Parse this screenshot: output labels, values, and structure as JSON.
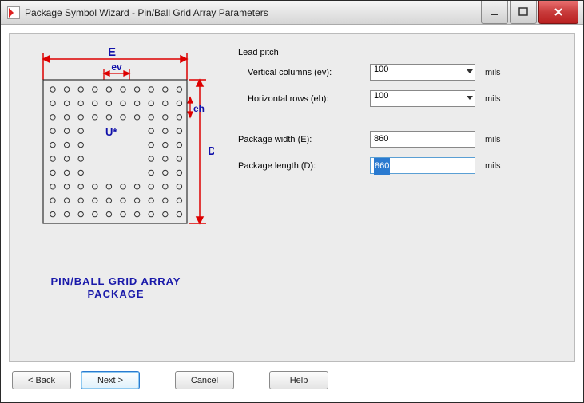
{
  "window": {
    "title": "Package Symbol Wizard - Pin/Ball Grid Array Parameters"
  },
  "diagram": {
    "dim_E": "E",
    "dim_ev": "ev",
    "dim_eh": "eh",
    "dim_D": "D",
    "refdes": "U*",
    "caption_line1": "PIN/BALL GRID ARRAY",
    "caption_line2": "PACKAGE"
  },
  "form": {
    "lead_pitch": {
      "group_label": "Lead pitch",
      "vertical": {
        "label": "Vertical columns (ev):",
        "value": "100",
        "unit": "mils"
      },
      "horizontal": {
        "label": "Horizontal rows (eh):",
        "value": "100",
        "unit": "mils"
      }
    },
    "width": {
      "label": "Package width (E):",
      "value": "860",
      "unit": "mils"
    },
    "length": {
      "label": "Package length (D):",
      "value": "860",
      "unit": "mils"
    }
  },
  "buttons": {
    "back": "< Back",
    "next": "Next >",
    "cancel": "Cancel",
    "help": "Help"
  }
}
